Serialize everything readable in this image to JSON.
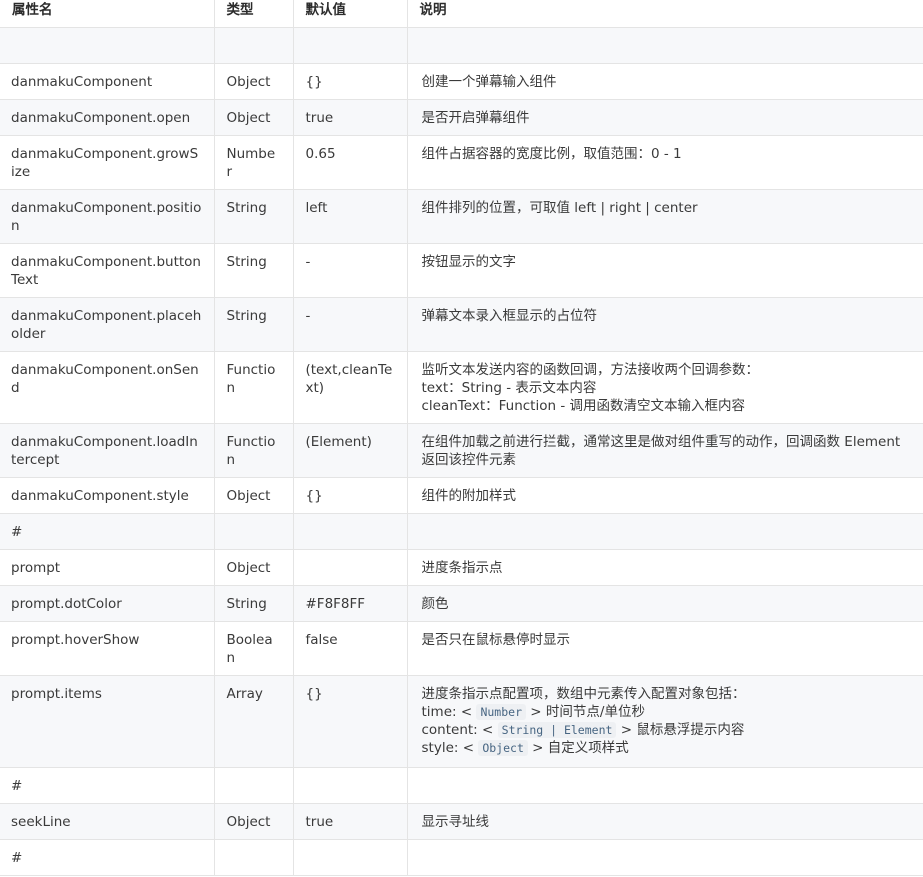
{
  "header": {
    "col1": "属性名",
    "col2": "类型",
    "col3": "默认值",
    "col4": "说明"
  },
  "rows": [
    {
      "name": "",
      "type": "",
      "default": "",
      "desc": ""
    },
    {
      "name": "danmakuComponent",
      "type": "Object",
      "default": "{}",
      "desc": "创建一个弹幕输入组件"
    },
    {
      "name": "danmakuComponent.open",
      "type": "Object",
      "default": "true",
      "desc": "是否开启弹幕组件"
    },
    {
      "name": "danmakuComponent.growSize",
      "type": "Number",
      "default": "0.65",
      "desc": "组件占据容器的宽度比例，取值范围：0 - 1"
    },
    {
      "name": "danmakuComponent.position",
      "type": "String",
      "default": "left",
      "desc": "组件排列的位置，可取值 left | right | center"
    },
    {
      "name": "danmakuComponent.buttonText",
      "type": "String",
      "default": "-",
      "desc": "按钮显示的文字"
    },
    {
      "name": "danmakuComponent.placeholder",
      "type": "String",
      "default": "-",
      "desc": "弹幕文本录入框显示的占位符"
    },
    {
      "name": "danmakuComponent.onSend",
      "type": "Function",
      "default": "(text,cleanText)",
      "desc_lines": [
        "监听文本发送内容的函数回调，方法接收两个回调参数：",
        "text：String - 表示文本内容",
        "cleanText：Function - 调用函数清空文本输入框内容"
      ]
    },
    {
      "name": "danmakuComponent.loadIntercept",
      "type": "Function",
      "default": "(Element)",
      "desc": "在组件加载之前进行拦截，通常这里是做对组件重写的动作，回调函数 Element 返回该控件元素"
    },
    {
      "name": "danmakuComponent.style",
      "type": "Object",
      "default": "{}",
      "desc": "组件的附加样式"
    },
    {
      "name": "#",
      "type": "",
      "default": "",
      "desc": ""
    },
    {
      "name": "prompt",
      "type": "Object",
      "default": "",
      "desc": "进度条指示点"
    },
    {
      "name": "prompt.dotColor",
      "type": "String",
      "default": "#F8F8FF",
      "desc": "颜色"
    },
    {
      "name": "prompt.hoverShow",
      "type": "Boolean",
      "default": "false",
      "desc": "是否只在鼠标悬停时显示"
    },
    {
      "name": "prompt.items",
      "type": "Array",
      "default": "{}",
      "desc_intro": "进度条指示点配置项，数组中元素传入配置对象包括：",
      "time_prefix": "time: < ",
      "time_code": "Number",
      "time_suffix": " > 时间节点/单位秒",
      "content_prefix": "content: < ",
      "content_code": "String | Element",
      "content_suffix": " > 鼠标悬浮提示内容",
      "style_prefix": "style: < ",
      "style_code": "Object",
      "style_suffix": " > 自定义项样式"
    },
    {
      "name": "#",
      "type": "",
      "default": "",
      "desc": ""
    },
    {
      "name": "seekLine",
      "type": "Object",
      "default": "true",
      "desc": "显示寻址线"
    },
    {
      "name": "#",
      "type": "",
      "default": "",
      "desc": ""
    }
  ]
}
